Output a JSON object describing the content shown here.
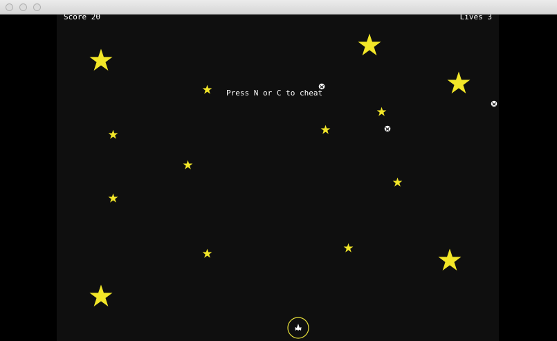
{
  "window": {
    "title_controls": [
      "close",
      "minimize",
      "maximize"
    ]
  },
  "hud": {
    "score_label": "Score 20",
    "lives_label": "Lives 3"
  },
  "message": {
    "cheat_hint": "Press N or C to cheat"
  },
  "colors": {
    "star": "#f2e628",
    "background": "#0f0f0f",
    "ship_ring": "#e8e13a",
    "text": "#ffffff"
  },
  "icons": {
    "star": "star-icon",
    "enemy": "enemy-icon",
    "ship": "player-ship-icon"
  }
}
